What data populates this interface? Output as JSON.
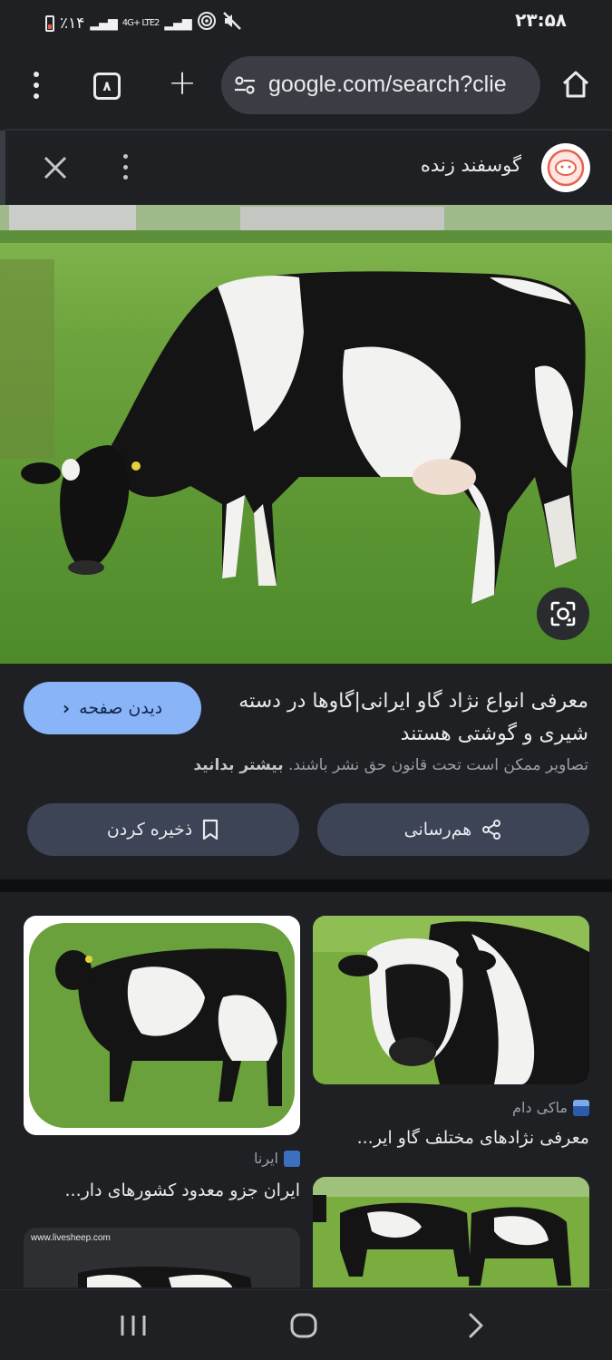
{
  "status": {
    "battery_text": "٪۱۴",
    "network": "4G+ LTE2",
    "time": "۲۳:۵۸"
  },
  "browser": {
    "tab_count": "۸",
    "url": "google.com/search?clie"
  },
  "panel": {
    "site_name": "گوسفند زنده"
  },
  "image_info": {
    "visit_label": "دیدن صفحه",
    "title": "معرفی انواع نژاد گاو ایرانی|گاوها در دسته شیری و گوشتی هستند",
    "copyright_text": "تصاویر ممکن است تحت قانون حق نشر باشند.",
    "learn_more": "بیشتر بدانید",
    "share_label": "هم‌رسانی",
    "save_label": "ذخیره کردن"
  },
  "related": [
    {
      "source": "ماکی دام",
      "title": "معرفی نژادهای مختلف گاو ایر..."
    },
    {
      "source": "ایرنا",
      "title": "ایران جزو معدود کشورهای دار..."
    },
    {
      "source": "",
      "title": ""
    },
    {
      "source": "",
      "title": "",
      "watermark": "www.livesheep.com"
    }
  ],
  "colors": {
    "background": "#1f2024",
    "accent": "#8ab4f8",
    "button_bg": "#3c4455"
  }
}
